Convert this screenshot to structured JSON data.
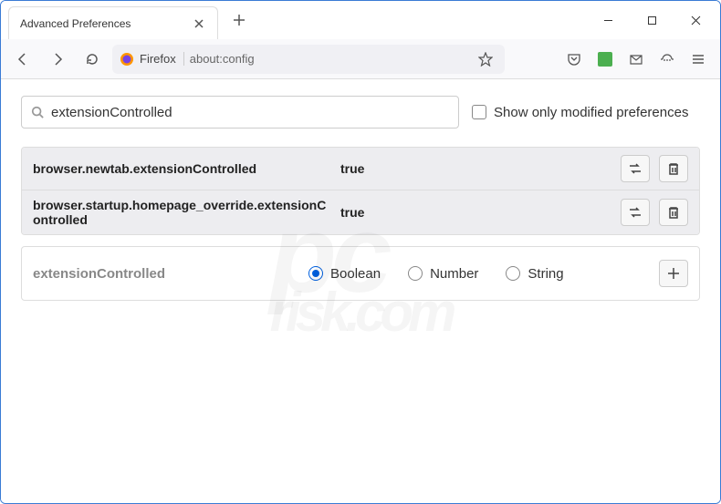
{
  "tab": {
    "title": "Advanced Preferences"
  },
  "urlbar": {
    "identity": "Firefox",
    "url": "about:config"
  },
  "search": {
    "value": "extensionControlled",
    "checkbox_label": "Show only modified preferences"
  },
  "prefs": [
    {
      "name": "browser.newtab.extensionControlled",
      "value": "true"
    },
    {
      "name": "browser.startup.homepage_override.extensionControlled",
      "value": "true"
    }
  ],
  "new_pref": {
    "name": "extensionControlled",
    "types": [
      "Boolean",
      "Number",
      "String"
    ],
    "selected": "Boolean"
  }
}
